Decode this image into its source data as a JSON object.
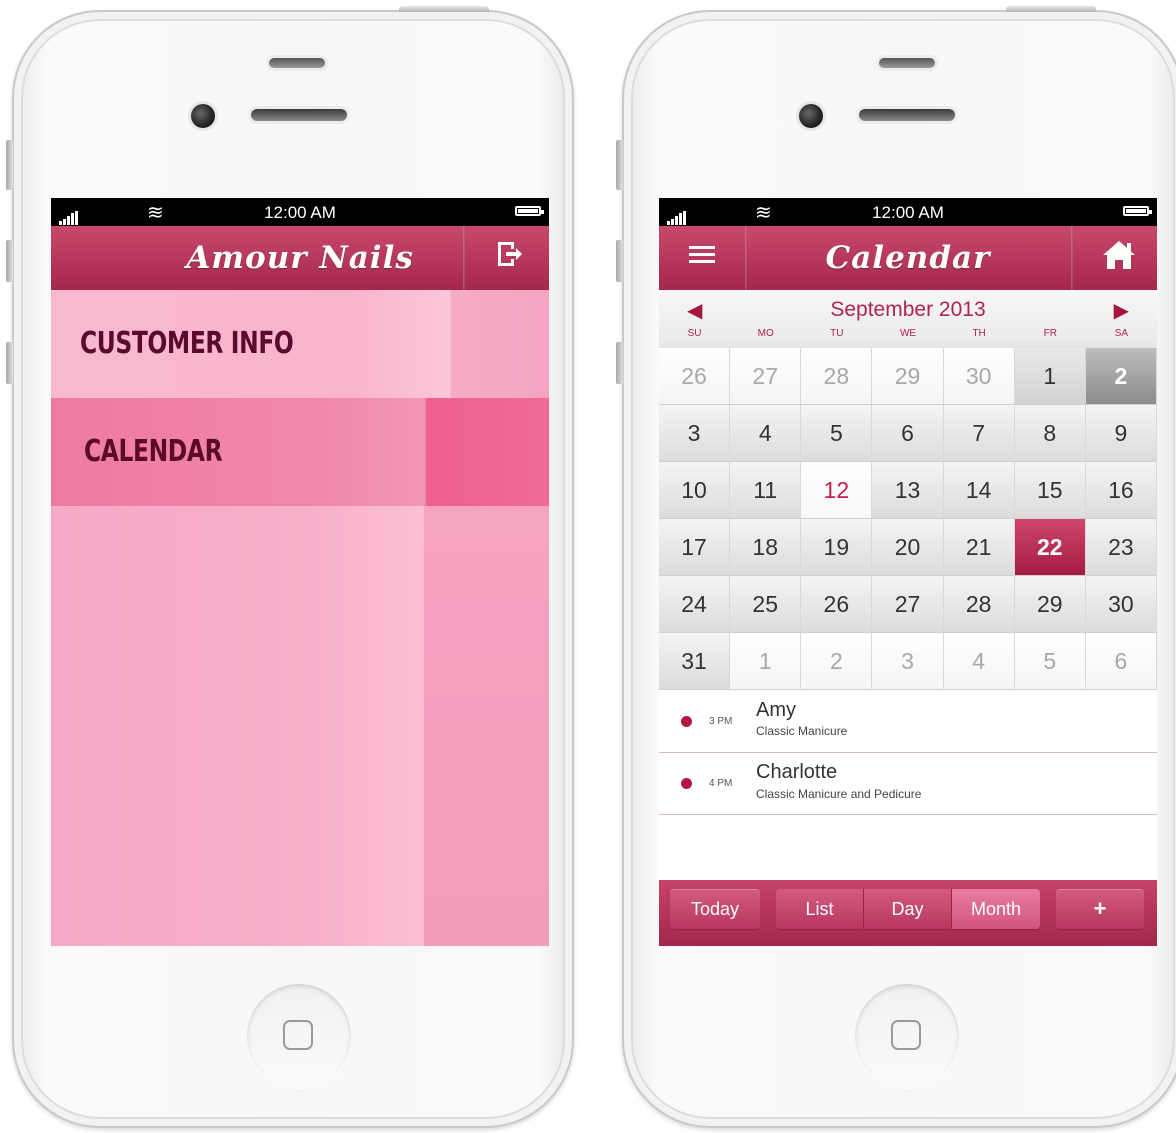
{
  "status_bar": {
    "time": "12:00 AM"
  },
  "left_screen": {
    "header_title": "Amour Nails",
    "logout_icon": "logout-icon",
    "menu": [
      {
        "label": "CUSTOMER INFO"
      },
      {
        "label": "CALENDAR"
      }
    ]
  },
  "right_screen": {
    "header_title": "Calendar",
    "menu_icon": "hamburger-icon",
    "home_icon": "home-icon",
    "month_label": "September 2013",
    "prev_arrow": "◀",
    "next_arrow": "▶",
    "weekdays": [
      "SU",
      "MO",
      "TU",
      "WE",
      "TH",
      "FR",
      "SA"
    ],
    "weeks": [
      [
        "26",
        "27",
        "28",
        "29",
        "30",
        "1",
        "2"
      ],
      [
        "3",
        "4",
        "5",
        "6",
        "7",
        "8",
        "9"
      ],
      [
        "10",
        "11",
        "12",
        "13",
        "14",
        "15",
        "16"
      ],
      [
        "17",
        "18",
        "19",
        "20",
        "21",
        "22",
        "23"
      ],
      [
        "24",
        "25",
        "26",
        "27",
        "28",
        "29",
        "30"
      ],
      [
        "31",
        "1",
        "2",
        "3",
        "4",
        "5",
        "6"
      ]
    ],
    "today_day": "12",
    "selected_day": "22",
    "events": [
      {
        "time": "3 PM",
        "name": "Amy",
        "service": "Classic Manicure"
      },
      {
        "time": "4 PM",
        "name": "Charlotte",
        "service": "Classic Manicure and Pedicure"
      }
    ],
    "toolbar": {
      "today": "Today",
      "list": "List",
      "day": "Day",
      "month": "Month",
      "add": "+"
    }
  },
  "colors": {
    "brand": "#b93a5e",
    "menu_pink": "#f6a9c6",
    "menu_active": "#ef7aa0",
    "accent_text": "#b0244e"
  }
}
